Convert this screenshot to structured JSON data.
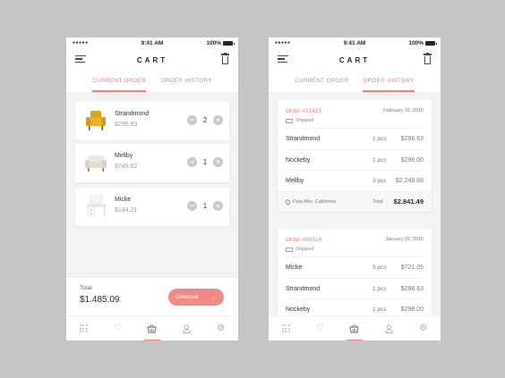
{
  "status_bar": {
    "signal": "●●●●●",
    "time": "9:41 AM",
    "battery": "100%"
  },
  "header": {
    "title": "CART"
  },
  "tabs": [
    {
      "label": "CURRENT ORDER"
    },
    {
      "label": "ORDER HISTORY"
    }
  ],
  "cart": {
    "items": [
      {
        "name": "Strandmond",
        "price": "$295.63",
        "qty": "2"
      },
      {
        "name": "Mellby",
        "price": "$749.62",
        "qty": "1"
      },
      {
        "name": "Micke",
        "price": "$144.21",
        "qty": "1"
      }
    ],
    "total_label": "Total",
    "total_value": "$1.485.09",
    "checkout_label": "Checkout",
    "checkout_arrow": "→"
  },
  "history": {
    "orders": [
      {
        "number": "Order #21421",
        "date": "February 16, 2016",
        "status": "Shipped",
        "items": [
          {
            "name": "Strandmond",
            "qty": "1 pcs",
            "price": "$296.63"
          },
          {
            "name": "Nockeby",
            "qty": "1 pcs",
            "price": "$296.00"
          },
          {
            "name": "Mellby",
            "qty": "3 pcs",
            "price": "$2.248.68"
          }
        ],
        "location": "Palo Alto, California",
        "total_label": "Total",
        "total_value": "$2.841.49"
      },
      {
        "number": "Order #69314",
        "date": "January 29, 2016",
        "status": "Shipped",
        "items": [
          {
            "name": "Micke",
            "qty": "5 pcs",
            "price": "$721.05"
          },
          {
            "name": "Strandmond",
            "qty": "1 pcs",
            "price": "$296.63"
          },
          {
            "name": "Nockeby",
            "qty": "1 pcs",
            "price": "$296.00"
          }
        ]
      }
    ]
  },
  "nav": [
    "grid-icon",
    "heart-icon",
    "basket-icon",
    "user-icon",
    "settings-icon"
  ],
  "colors": {
    "accent": "#ef7d7d",
    "button": "#f08a86",
    "background": "#c5c5c5"
  }
}
